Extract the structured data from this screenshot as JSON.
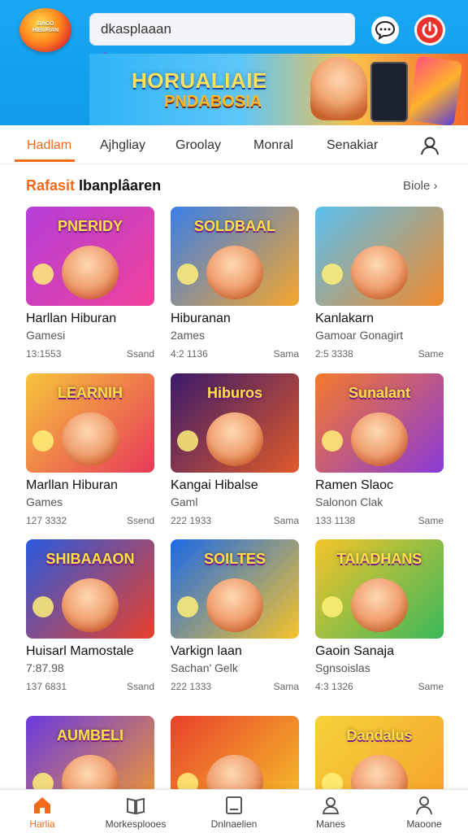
{
  "header": {
    "logo_text": "BACO\nHIBURAN",
    "search_placeholder": "dkasplaaan",
    "banner_title": "HORUALIAIE",
    "banner_subtitle": "PNDABOSIA"
  },
  "tabs": [
    {
      "label": "Hadlam",
      "active": true
    },
    {
      "label": "Ajhgliay",
      "active": false
    },
    {
      "label": "Groolay",
      "active": false
    },
    {
      "label": "Monral",
      "active": false
    },
    {
      "label": "Senakiar",
      "active": false
    }
  ],
  "section": {
    "title_accent": "Rafasit",
    "title_rest": "Ibanplâaren",
    "see_more": "Biole"
  },
  "games": [
    {
      "thumb_text": "PNERIDY",
      "title": "Harllan Hiburan",
      "sub": "Gamesi",
      "stat": "13:1553",
      "tag": "Ssand",
      "c1": "#b43fd8",
      "c2": "#f0409a"
    },
    {
      "thumb_text": "SOLDBAAL",
      "title": "Hiburanan",
      "sub": "2ames",
      "stat": "4:2 1136",
      "tag": "Sama",
      "c1": "#3a7ee8",
      "c2": "#f5a62c"
    },
    {
      "thumb_text": "",
      "title": "Kanlakarn",
      "sub": "Gamoar Gonagirt",
      "stat": "2:5 3338",
      "tag": "Same",
      "c1": "#58c0f0",
      "c2": "#f28a2a"
    },
    {
      "thumb_text": "LEARNIH",
      "title": "Marllan Hiburan",
      "sub": "Games",
      "stat": "127 3332",
      "tag": "Ssend",
      "c1": "#f5c43a",
      "c2": "#e83a5a"
    },
    {
      "thumb_text": "Hiburos",
      "title": "Kangai Hibalse",
      "sub": "Gaml",
      "stat": "222 1933",
      "tag": "Sama",
      "c1": "#3a1a6a",
      "c2": "#e05a2a"
    },
    {
      "thumb_text": "Sunalant",
      "title": "Ramen Slaoc",
      "sub": "Salonon Clak",
      "stat": "133 1138",
      "tag": "Same",
      "c1": "#f57a2a",
      "c2": "#8a3ad8"
    },
    {
      "thumb_text": "SHIBAAAON",
      "title": "Huisarl Mamostale",
      "sub": "7:87.98",
      "stat": "137 6831",
      "tag": "Ssand",
      "c1": "#2a5ae0",
      "c2": "#e8402a"
    },
    {
      "thumb_text": "SOILTES",
      "title": "Varkign laan",
      "sub": "Sachan' Gelk",
      "stat": "222 1333",
      "tag": "Sama",
      "c1": "#1a6ae8",
      "c2": "#f5c42a"
    },
    {
      "thumb_text": "TAIADHANS",
      "title": "Gaoin Sanaja",
      "sub": "Sgnsoislas",
      "stat": "4:3 1326",
      "tag": "Same",
      "c1": "#f5c42a",
      "c2": "#3ab85a"
    },
    {
      "thumb_text": "AUMBELI",
      "title": "",
      "sub": "",
      "stat": "",
      "tag": "",
      "c1": "#6a3ae0",
      "c2": "#f59a2a"
    },
    {
      "thumb_text": "",
      "title": "",
      "sub": "",
      "stat": "",
      "tag": "",
      "c1": "#e8402a",
      "c2": "#f5c42a"
    },
    {
      "thumb_text": "Dandalus",
      "title": "",
      "sub": "",
      "stat": "",
      "tag": "",
      "c1": "#f5d23a",
      "c2": "#f5a02a"
    }
  ],
  "bottom_nav": [
    {
      "label": "Harlia",
      "icon": "home-icon",
      "active": true
    },
    {
      "label": "Morkesplooes",
      "icon": "book-icon",
      "active": false
    },
    {
      "label": "Dnlnaelien",
      "icon": "square-icon",
      "active": false
    },
    {
      "label": "Manes",
      "icon": "user-icon",
      "active": false
    },
    {
      "label": "Maoone",
      "icon": "person-icon",
      "active": false
    }
  ],
  "colors": {
    "accent": "#f26a1b",
    "header_blue": "#12a0ee",
    "notification_red": "#e8322c"
  }
}
